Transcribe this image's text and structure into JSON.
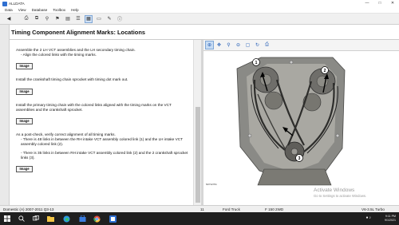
{
  "window": {
    "title": "ALLDATA"
  },
  "menu": [
    "Data",
    "View",
    "Database",
    "Toolbox",
    "Help"
  ],
  "toolbar": {
    "buttons": [
      "back-icon",
      "print-icon",
      "copy-icon",
      "zoom-icon",
      "bookmark-icon",
      "document-icon",
      "list-icon",
      "grid-icon",
      "page-icon",
      "note-icon",
      "info-icon"
    ]
  },
  "header": {
    "title": "Timing Component Alignment Marks:  Locations"
  },
  "steps": [
    {
      "text": "Assemble the 2 LH VCT assemblies and the LH secondary timing chain.",
      "bullets": [
        "Align the colored links with the timing marks."
      ],
      "button": "Image"
    },
    {
      "text": "Install the crankshaft timing chain sprocket with timing dot mark out.",
      "bullets": [],
      "button": "Image"
    },
    {
      "text": "Install the primary timing chain with the colored links aligned with the timing marks on the VCT assemblies and the crankshaft sprocket.",
      "bullets": [],
      "button": "Image"
    },
    {
      "text": "As a post-check, verify correct alignment of all timing marks.",
      "bullets": [
        "There is 48 links in between the RH intake VCT assembly colored link (1) and the LH intake VCT assembly colored link (2).",
        "There is 35 links in between RH intake VCT assembly colored link (2) and the 2 crankshaft sprocket links (3)."
      ],
      "button": "Image"
    }
  ],
  "figure": {
    "callouts": [
      "1",
      "2",
      "3"
    ],
    "id": "N0712701"
  },
  "watermark": {
    "line1": "Activate Windows",
    "line2": "Go to Settings to activate Windows."
  },
  "status": {
    "database": "Domestic (A) 2007-2011 Q3-13",
    "page": "11",
    "make": "Ford Truck",
    "model": "F 150 2WD",
    "engine": "V6-3.5L Turbo"
  },
  "tray": {
    "time": "9:11 PM",
    "date": "9/1/2021"
  },
  "colors": {
    "accent": "#2f6fd1",
    "taskbar": "#1f1f1f"
  }
}
